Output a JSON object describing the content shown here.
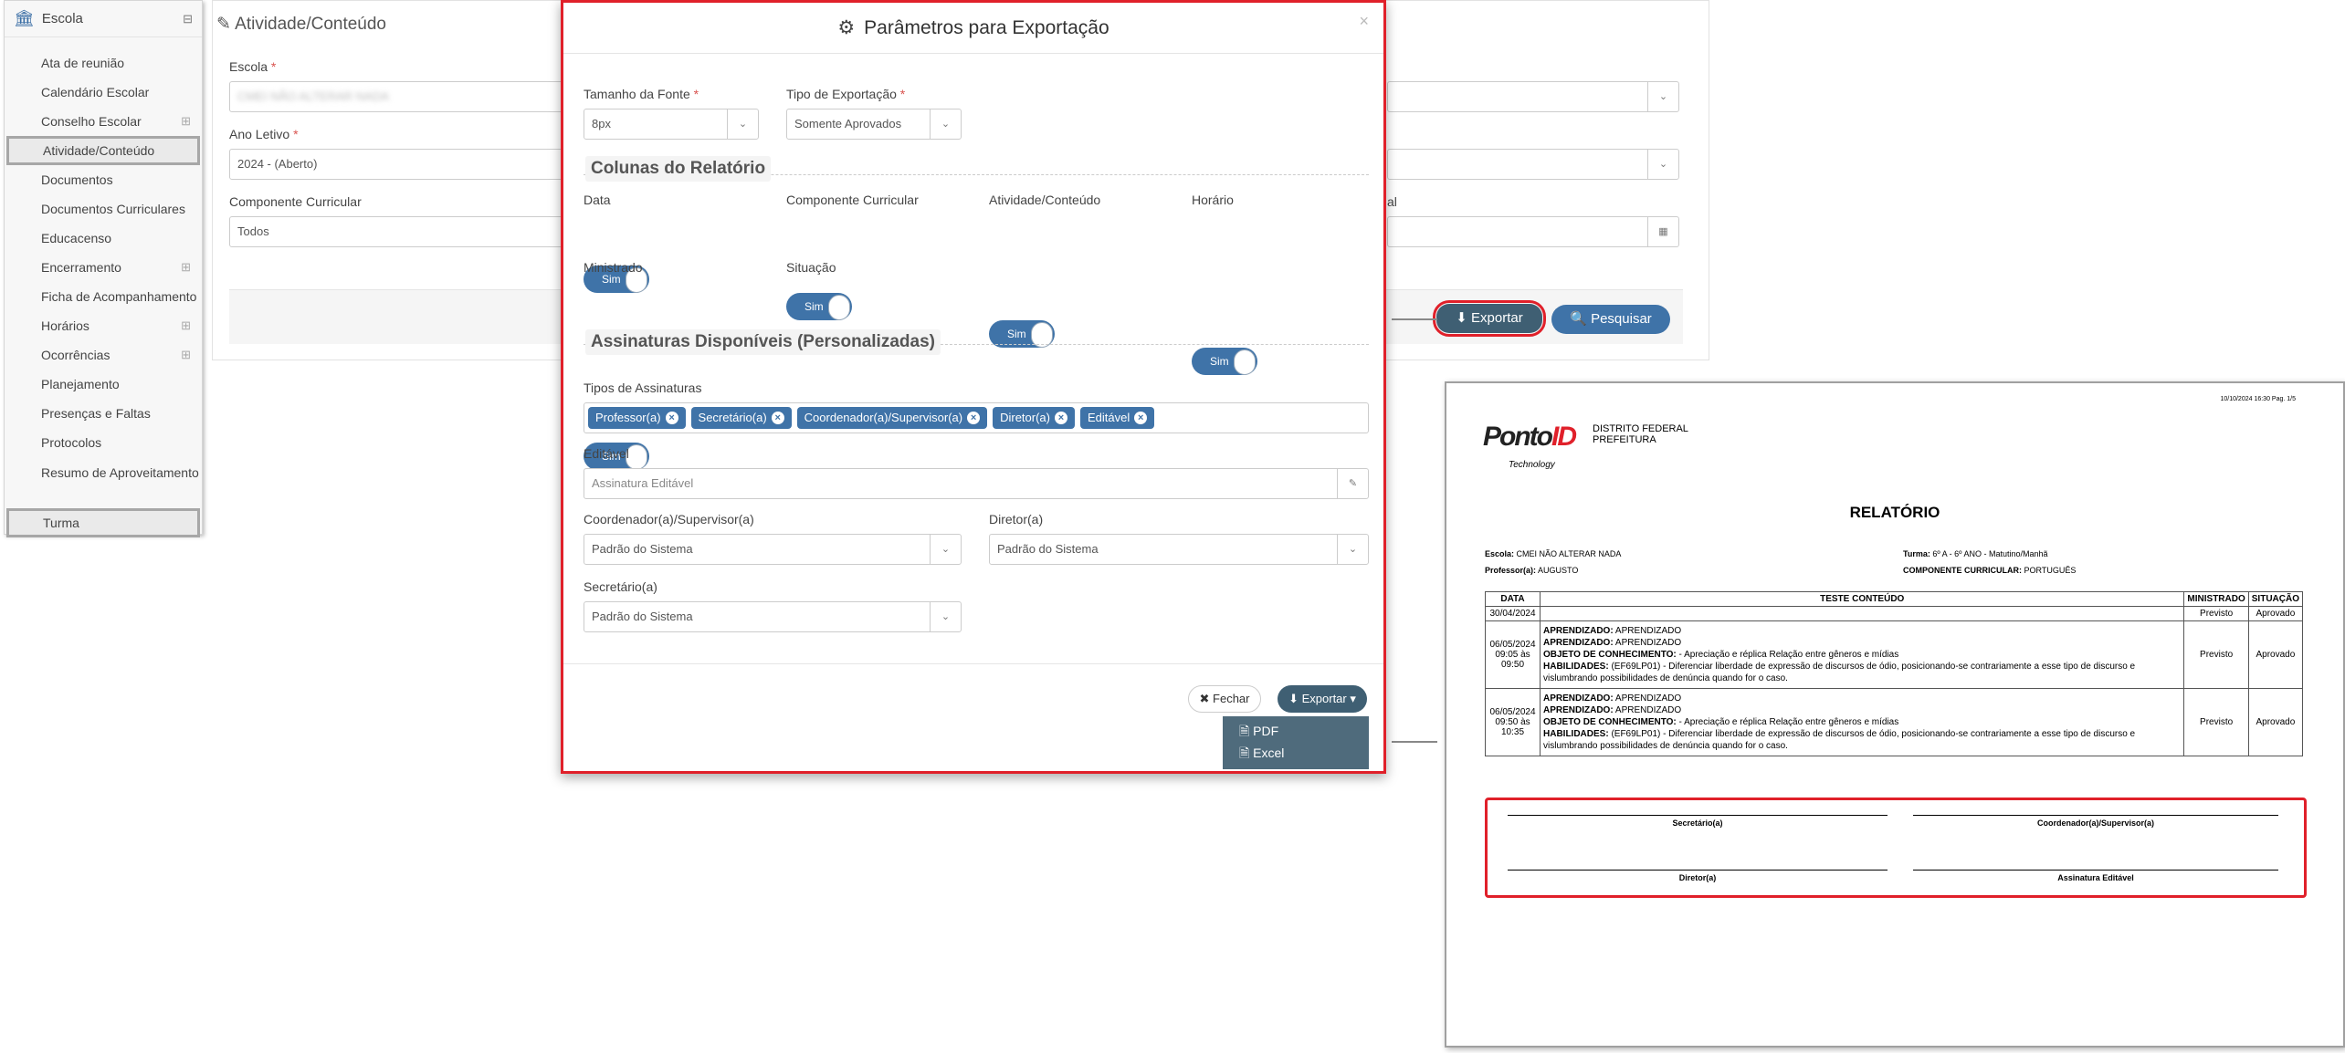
{
  "sidebar": {
    "header": "Escola",
    "items": [
      {
        "label": "Ata de reunião",
        "plus": false
      },
      {
        "label": "Calendário Escolar",
        "plus": false
      },
      {
        "label": "Conselho Escolar",
        "plus": true
      },
      {
        "label": "Atividade/Conteúdo",
        "plus": false,
        "highlight": true
      },
      {
        "label": "Documentos",
        "plus": false
      },
      {
        "label": "Documentos Curriculares",
        "plus": false
      },
      {
        "label": "Educacenso",
        "plus": false
      },
      {
        "label": "Encerramento",
        "plus": true
      },
      {
        "label": "Ficha de Acompanhamento",
        "plus": false
      },
      {
        "label": "Horários",
        "plus": true
      },
      {
        "label": "Ocorrências",
        "plus": true
      },
      {
        "label": "Planejamento",
        "plus": false
      },
      {
        "label": "Presenças e Faltas",
        "plus": false
      },
      {
        "label": "Protocolos",
        "plus": false
      },
      {
        "label": "Resumo de Aproveitamento",
        "plus": false,
        "two": true
      },
      {
        "label": "Turma",
        "plus": false,
        "highlight": true
      }
    ]
  },
  "main": {
    "title": "Atividade/Conteúdo",
    "escola_label": "Escola",
    "ano_label": "Ano Letivo",
    "ano_value": "2024 - (Aberto)",
    "componente_label": "Componente Curricular",
    "componente_value": "Todos",
    "partial_label": "al",
    "exportar": "Exportar",
    "pesquisar": "Pesquisar"
  },
  "modal": {
    "title": "Parâmetros para Exportação",
    "fonte_label": "Tamanho da Fonte",
    "fonte_value": "8px",
    "tipo_label": "Tipo de Exportação",
    "tipo_value": "Somente Aprovados",
    "colunas_title": "Colunas do Relatório",
    "toggles": [
      {
        "label": "Data",
        "value": "Sim"
      },
      {
        "label": "Componente Curricular",
        "value": "Sim"
      },
      {
        "label": "Atividade/Conteúdo",
        "value": "Sim"
      },
      {
        "label": "Horário",
        "value": "Sim"
      },
      {
        "label": "Ministrado",
        "value": "Sim"
      },
      {
        "label": "Situação",
        "value": "Sim"
      }
    ],
    "assinaturas_title": "Assinaturas Disponíveis (Personalizadas)",
    "tipos_label": "Tipos de Assinaturas",
    "chips": [
      "Professor(a)",
      "Secretário(a)",
      "Coordenador(a)/Supervisor(a)",
      "Diretor(a)",
      "Editável"
    ],
    "editavel_label": "Editável",
    "editavel_placeholder": "Assinatura Editável",
    "coord_label": "Coordenador(a)/Supervisor(a)",
    "coord_value": "Padrão do Sistema",
    "diretor_label": "Diretor(a)",
    "diretor_value": "Padrão do Sistema",
    "secretario_label": "Secretário(a)",
    "secretario_value": "Padrão do Sistema",
    "fechar": "Fechar",
    "exportar": "Exportar",
    "menu": [
      "PDF",
      "Excel"
    ]
  },
  "report": {
    "stamp": "10/10/2024 16:30  Pag. 1/5",
    "logo_text": "PontoID",
    "logo_sub": "Technology",
    "org1": "DISTRITO FEDERAL",
    "org2": "PREFEITURA",
    "title": "RELATÓRIO",
    "escola_k": "Escola:",
    "escola_v": "CMEI NÃO ALTERAR NADA",
    "prof_k": "Professor(a):",
    "prof_v": "AUGUSTO",
    "turma_k": "Turma:",
    "turma_v": "6º A - 6º ANO - Matutino/Manhã",
    "comp_k": "COMPONENTE CURRICULAR:",
    "comp_v": "PORTUGUÊS",
    "headers": [
      "DATA",
      "TESTE CONTEÚDO",
      "MINISTRADO",
      "SITUAÇÃO"
    ],
    "row1": {
      "data": "30/04/2024",
      "min": "Previsto",
      "sit": "Aprovado"
    },
    "rows": [
      {
        "data": "06/05/2024 09:05 às 09:50",
        "min": "Previsto",
        "sit": "Aprovado"
      },
      {
        "data": "06/05/2024 09:50 às 10:35",
        "min": "Previsto",
        "sit": "Aprovado"
      }
    ],
    "ap_k": "APRENDIZADO:",
    "ap_v": "APRENDIZADO",
    "obj_k": "OBJETO DE CONHECIMENTO:",
    "obj_v": " - Apreciação e réplica Relação entre gêneros e mídias",
    "hab_k": "HABILIDADES:",
    "hab_v": "(EF69LP01) - Diferenciar liberdade de expressão de discursos de ódio, posicionando-se contrariamente a esse tipo de discurso e vislumbrando possibilidades de denúncia quando for o caso.",
    "sig": [
      "Secretário(a)",
      "Coordenador(a)/Supervisor(a)",
      "Diretor(a)",
      "Assinatura Editável"
    ]
  }
}
